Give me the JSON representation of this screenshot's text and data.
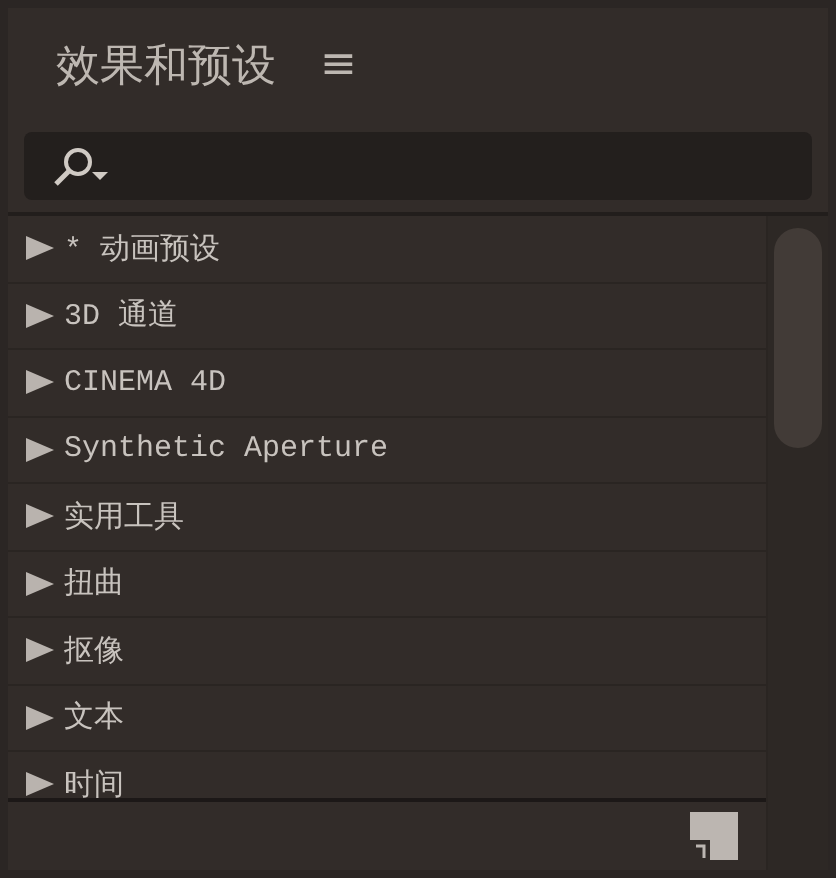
{
  "panel": {
    "title": "效果和预设",
    "menu_icon": "≡"
  },
  "items": [
    {
      "label": "* 动画预设",
      "expanded": false
    },
    {
      "label": "3D 通道",
      "expanded": false
    },
    {
      "label": "CINEMA 4D",
      "expanded": false
    },
    {
      "label": "Synthetic Aperture",
      "expanded": false
    },
    {
      "label": "实用工具",
      "expanded": false
    },
    {
      "label": "扭曲",
      "expanded": false
    },
    {
      "label": "抠像",
      "expanded": false
    },
    {
      "label": "文本",
      "expanded": false
    },
    {
      "label": "时间",
      "expanded": false
    }
  ]
}
